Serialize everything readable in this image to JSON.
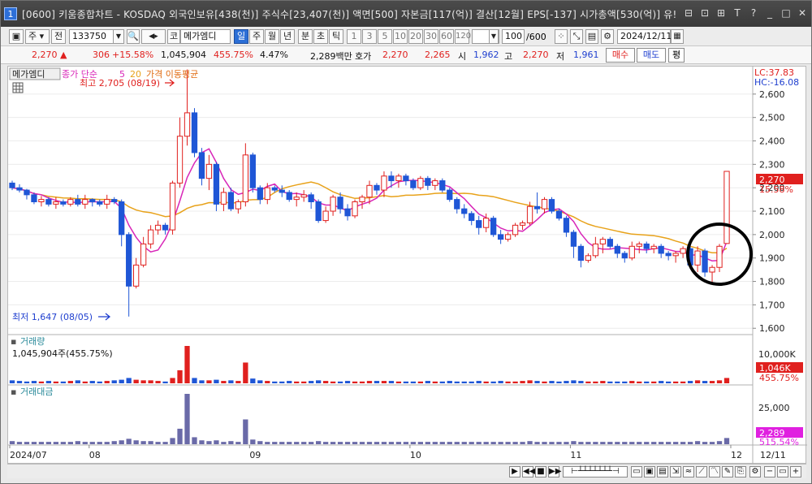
{
  "title": {
    "number": "1",
    "text": "[0600] 키움종합차트 - KOSDAQ 외국인보유[438(천)] 주식수[23,407(천)] 액면[500] 자본금[117(억)] 결산[12월] EPS[-137] 시가총액[530(억)] 유!"
  },
  "window_buttons": [
    "⊟",
    "⊡",
    "⊞",
    "T",
    "?",
    "_",
    "□",
    "✕"
  ],
  "toolbar": {
    "market": "주",
    "jeon": "전",
    "code": "133750",
    "market2": "코",
    "name": "메가엠디",
    "periods": [
      "일",
      "주",
      "월",
      "년",
      "분",
      "초",
      "틱"
    ],
    "active_period": "일",
    "intervals": [
      "1",
      "3",
      "5",
      "10",
      "20",
      "30",
      "60",
      "120"
    ],
    "count": "100",
    "count_max": "/600",
    "date": "2024/12/11"
  },
  "quote": {
    "price": "2,270",
    "arrow": "▲",
    "change": "306",
    "change_pct": "+15.58%",
    "volume": "1,045,904",
    "volume_pct": "455.75%",
    "turnover": "4.47%",
    "amount": "2,289백만",
    "ask_label": "호가",
    "ask": "2,270",
    "bid": "2,265",
    "open_label": "시",
    "open": "1,962",
    "high_label": "고",
    "high": "2,270",
    "low_label": "저",
    "low": "1,961",
    "buy_btn": "매수",
    "sell_btn": "매도",
    "avg_btn": "평"
  },
  "legend": {
    "name": "메가엠디",
    "ma_label": "종가 단순",
    "ma_short": "5",
    "ma_long": "20",
    "ma_title": "가격 이동평균",
    "lc": "LC:37.83",
    "hc": "HC:-16.08"
  },
  "annotations": {
    "high_text": "최고 2,705 (08/19)",
    "low_text": "최저 1,647 (08/05)"
  },
  "price_axis": {
    "ticks": [
      "2,600",
      "2,500",
      "2,400",
      "2,300",
      "2,200",
      "2,100",
      "2,000",
      "1,900",
      "1,800",
      "1,700",
      "1,600"
    ],
    "last_price": "2,270",
    "last_pct": "15.58%"
  },
  "volume_panel": {
    "title": "거래량",
    "info": "1,045,904주(455.75%)",
    "axis_tick": "10,000K",
    "last_value": "1,046K",
    "last_pct": "455.75%"
  },
  "amount_panel": {
    "title": "거래대금",
    "axis_tick": "25,000",
    "last_value": "2,289",
    "last_pct": "515.54%"
  },
  "date_axis": [
    "2024/07",
    "08",
    "09",
    "10",
    "11",
    "12"
  ],
  "date_axis_last": "12/11",
  "colors": {
    "up": "#e0201e",
    "down": "#1f56d6",
    "ma5": "#d826b8",
    "ma20": "#e8a21a",
    "amount": "#6a6aa8",
    "marker_circle": "#000000",
    "last_price_box": "#e0201e",
    "last_amount_box": "#e020e0"
  },
  "chart_data": {
    "type": "candlestick",
    "y_range": [
      1580,
      2700
    ],
    "ohlc": [
      [
        2220,
        2230,
        2190,
        2200
      ],
      [
        2200,
        2215,
        2180,
        2190
      ],
      [
        2190,
        2195,
        2150,
        2170
      ],
      [
        2170,
        2180,
        2130,
        2140
      ],
      [
        2140,
        2165,
        2120,
        2150
      ],
      [
        2150,
        2160,
        2120,
        2130
      ],
      [
        2130,
        2160,
        2110,
        2140
      ],
      [
        2140,
        2150,
        2120,
        2130
      ],
      [
        2130,
        2160,
        2120,
        2150
      ],
      [
        2150,
        2170,
        2120,
        2130
      ],
      [
        2130,
        2170,
        2110,
        2150
      ],
      [
        2150,
        2155,
        2120,
        2140
      ],
      [
        2140,
        2150,
        2120,
        2130
      ],
      [
        2130,
        2170,
        2110,
        2150
      ],
      [
        2150,
        2160,
        2130,
        2140
      ],
      [
        2140,
        2150,
        1950,
        2000
      ],
      [
        2000,
        2010,
        1650,
        1780
      ],
      [
        1780,
        1900,
        1770,
        1870
      ],
      [
        1870,
        1990,
        1860,
        1960
      ],
      [
        1960,
        2040,
        1940,
        2020
      ],
      [
        2020,
        2060,
        2000,
        2040
      ],
      [
        2040,
        2050,
        2000,
        2020
      ],
      [
        2020,
        2230,
        2000,
        2220
      ],
      [
        2220,
        2500,
        2200,
        2420
      ],
      [
        2420,
        2705,
        2380,
        2520
      ],
      [
        2520,
        2540,
        2330,
        2350
      ],
      [
        2350,
        2370,
        2210,
        2240
      ],
      [
        2240,
        2340,
        2190,
        2300
      ],
      [
        2300,
        2310,
        2100,
        2130
      ],
      [
        2130,
        2200,
        2100,
        2180
      ],
      [
        2180,
        2200,
        2100,
        2110
      ],
      [
        2110,
        2150,
        2090,
        2140
      ],
      [
        2140,
        2390,
        2120,
        2340
      ],
      [
        2340,
        2350,
        2180,
        2200
      ],
      [
        2200,
        2210,
        2130,
        2150
      ],
      [
        2150,
        2220,
        2130,
        2200
      ],
      [
        2200,
        2210,
        2180,
        2190
      ],
      [
        2190,
        2210,
        2160,
        2180
      ],
      [
        2180,
        2190,
        2140,
        2150
      ],
      [
        2150,
        2180,
        2120,
        2160
      ],
      [
        2160,
        2190,
        2140,
        2170
      ],
      [
        2170,
        2180,
        2110,
        2140
      ],
      [
        2140,
        2150,
        2050,
        2060
      ],
      [
        2060,
        2120,
        2050,
        2100
      ],
      [
        2100,
        2170,
        2080,
        2160
      ],
      [
        2160,
        2180,
        2090,
        2110
      ],
      [
        2110,
        2130,
        2060,
        2080
      ],
      [
        2080,
        2150,
        2070,
        2140
      ],
      [
        2140,
        2170,
        2110,
        2160
      ],
      [
        2160,
        2230,
        2130,
        2210
      ],
      [
        2210,
        2220,
        2170,
        2190
      ],
      [
        2190,
        2270,
        2160,
        2250
      ],
      [
        2250,
        2270,
        2200,
        2230
      ],
      [
        2230,
        2260,
        2200,
        2250
      ],
      [
        2250,
        2260,
        2210,
        2230
      ],
      [
        2230,
        2240,
        2190,
        2200
      ],
      [
        2200,
        2250,
        2190,
        2240
      ],
      [
        2240,
        2250,
        2190,
        2210
      ],
      [
        2210,
        2240,
        2190,
        2230
      ],
      [
        2230,
        2240,
        2180,
        2190
      ],
      [
        2190,
        2200,
        2140,
        2150
      ],
      [
        2150,
        2160,
        2090,
        2110
      ],
      [
        2110,
        2130,
        2070,
        2090
      ],
      [
        2090,
        2100,
        2040,
        2060
      ],
      [
        2060,
        2080,
        2000,
        2030
      ],
      [
        2030,
        2090,
        2010,
        2070
      ],
      [
        2070,
        2080,
        1990,
        2000
      ],
      [
        2000,
        2020,
        1960,
        1980
      ],
      [
        1980,
        2010,
        1970,
        2000
      ],
      [
        2000,
        2050,
        1990,
        2040
      ],
      [
        2040,
        2060,
        2020,
        2050
      ],
      [
        2050,
        2140,
        2040,
        2120
      ],
      [
        2120,
        2180,
        2090,
        2110
      ],
      [
        2110,
        2160,
        2090,
        2150
      ],
      [
        2150,
        2160,
        2090,
        2100
      ],
      [
        2100,
        2110,
        2060,
        2070
      ],
      [
        2070,
        2080,
        1990,
        2010
      ],
      [
        2010,
        2020,
        1900,
        1950
      ],
      [
        1950,
        1960,
        1860,
        1890
      ],
      [
        1890,
        1920,
        1880,
        1910
      ],
      [
        1910,
        1990,
        1900,
        1960
      ],
      [
        1960,
        1990,
        1920,
        1980
      ],
      [
        1980,
        1990,
        1940,
        1950
      ],
      [
        1950,
        1960,
        1900,
        1920
      ],
      [
        1920,
        1930,
        1880,
        1900
      ],
      [
        1900,
        1970,
        1890,
        1950
      ],
      [
        1950,
        1970,
        1920,
        1960
      ],
      [
        1960,
        1970,
        1920,
        1940
      ],
      [
        1940,
        1960,
        1920,
        1950
      ],
      [
        1950,
        1960,
        1900,
        1920
      ],
      [
        1920,
        1930,
        1890,
        1910
      ],
      [
        1910,
        1930,
        1880,
        1920
      ],
      [
        1920,
        1950,
        1900,
        1940
      ],
      [
        1940,
        1960,
        1860,
        1870
      ],
      [
        1870,
        1950,
        1840,
        1930
      ],
      [
        1930,
        1940,
        1820,
        1840
      ],
      [
        1840,
        1870,
        1790,
        1860
      ],
      [
        1860,
        1960,
        1840,
        1950
      ],
      [
        1962,
        2270,
        1961,
        2270
      ]
    ],
    "volume_relative": [
      5,
      4,
      3,
      4,
      3,
      4,
      3,
      3,
      4,
      5,
      3,
      4,
      3,
      4,
      5,
      6,
      9,
      6,
      5,
      5,
      4,
      3,
      9,
      22,
      63,
      9,
      5,
      5,
      6,
      4,
      5,
      4,
      35,
      8,
      5,
      4,
      3,
      3,
      4,
      3,
      3,
      4,
      5,
      4,
      3,
      3,
      4,
      3,
      3,
      4,
      4,
      4,
      4,
      3,
      3,
      3,
      3,
      4,
      3,
      3,
      4,
      3,
      3,
      3,
      4,
      3,
      3,
      4,
      3,
      3,
      4,
      5,
      4,
      3,
      4,
      3,
      4,
      5,
      4,
      3,
      3,
      4,
      3,
      3,
      3,
      4,
      3,
      3,
      3,
      4,
      3,
      3,
      3,
      4,
      5,
      4,
      4,
      5,
      9
    ],
    "amount_relative": [
      4,
      3,
      3,
      3,
      3,
      3,
      3,
      3,
      3,
      4,
      3,
      3,
      3,
      3,
      4,
      5,
      7,
      5,
      4,
      4,
      3,
      3,
      8,
      20,
      65,
      9,
      5,
      4,
      5,
      3,
      4,
      3,
      32,
      6,
      4,
      3,
      3,
      3,
      3,
      3,
      3,
      3,
      4,
      3,
      3,
      3,
      3,
      3,
      3,
      3,
      3,
      3,
      3,
      3,
      3,
      3,
      3,
      3,
      3,
      3,
      3,
      3,
      3,
      3,
      3,
      3,
      3,
      3,
      3,
      3,
      3,
      4,
      3,
      3,
      3,
      3,
      3,
      4,
      3,
      3,
      3,
      3,
      3,
      3,
      3,
      3,
      3,
      3,
      3,
      3,
      3,
      3,
      3,
      3,
      4,
      3,
      3,
      4,
      8
    ]
  }
}
